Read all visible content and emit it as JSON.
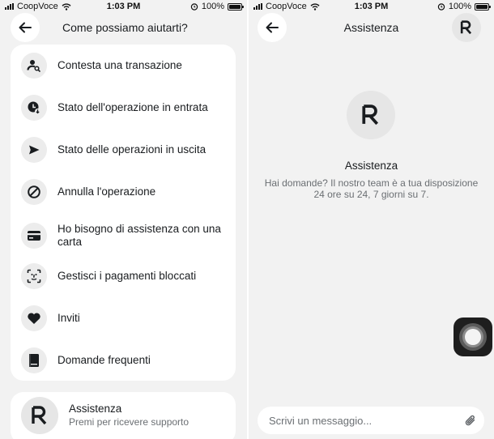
{
  "left": {
    "status_bar": {
      "carrier": "CoopVoce",
      "time": "1:03 PM",
      "battery": "100%",
      "battery_level": 1.0
    },
    "header": {
      "title": "Come possiamo aiutarti?"
    },
    "menu": [
      {
        "label": "Contesta una transazione",
        "icon": "person-search-icon"
      },
      {
        "label": "Stato dell'operazione in entrata",
        "icon": "incoming-transfer-icon"
      },
      {
        "label": "Stato delle operazioni in uscita",
        "icon": "send-icon"
      },
      {
        "label": "Annulla l'operazione",
        "icon": "cancel-icon"
      },
      {
        "label": "Ho bisogno di assistenza con una carta",
        "icon": "credit-card-icon"
      },
      {
        "label": "Gestisci i pagamenti bloccati",
        "icon": "face-scan-icon"
      },
      {
        "label": "Inviti",
        "icon": "heart-icon"
      },
      {
        "label": "Domande frequenti",
        "icon": "book-icon"
      }
    ],
    "support_card": {
      "title": "Assistenza",
      "subtitle": "Premi per ricevere supporto",
      "logo": "R"
    }
  },
  "right": {
    "status_bar": {
      "carrier": "CoopVoce",
      "time": "1:03 PM",
      "battery": "100%",
      "battery_level": 1.0
    },
    "header": {
      "title": "Assistenza",
      "avatar": "R"
    },
    "intro": {
      "logo": "R",
      "title": "Assistenza",
      "description_line1": "Hai domande? Il nostro team è a tua disposizione",
      "description_line2": "24 ore su 24, 7 giorni su 7."
    },
    "composer": {
      "placeholder": "Scrivi un messaggio..."
    }
  },
  "colors": {
    "background": "#f2f2f2",
    "card": "#ffffff",
    "icon_circle": "#ececec",
    "text": "#191c1f",
    "muted": "#6b6f73"
  }
}
